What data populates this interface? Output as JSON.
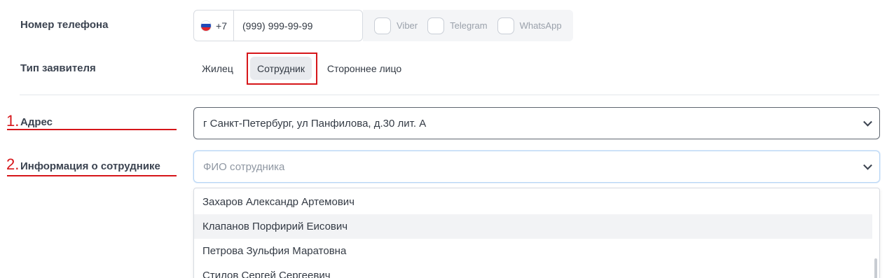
{
  "phone": {
    "label": "Номер телефона",
    "country_code": "+7",
    "value": "(999) 999-99-99",
    "flag_colors": [
      "#ffffff",
      "#1f49b7",
      "#e0242c"
    ],
    "messengers": [
      {
        "label": "Viber",
        "checked": false
      },
      {
        "label": "Telegram",
        "checked": false
      },
      {
        "label": "WhatsApp",
        "checked": false
      }
    ]
  },
  "applicant_type": {
    "label": "Тип заявителя",
    "options": [
      "Жилец",
      "Сотрудник",
      "Стороннее лицо"
    ],
    "selected": "Сотрудник"
  },
  "address": {
    "marker": "1.",
    "label": "Адрес",
    "value": "г Санкт-Петербург, ул Панфилова, д.30 лит. А"
  },
  "employee_info": {
    "marker": "2.",
    "label": "Информация о сотруднике",
    "placeholder": "ФИО сотрудника",
    "options": [
      "Захаров Александр Артемович",
      "Клапанов Порфирий Еисович",
      "Петрова Зульфия Маратовна",
      "Стилов Сергей Сергеевич"
    ],
    "hovered_option": "Клапанов Порфирий Еисович"
  },
  "colors": {
    "annotation_red": "#d6161a",
    "active_segment_bg": "#e8eaee"
  }
}
